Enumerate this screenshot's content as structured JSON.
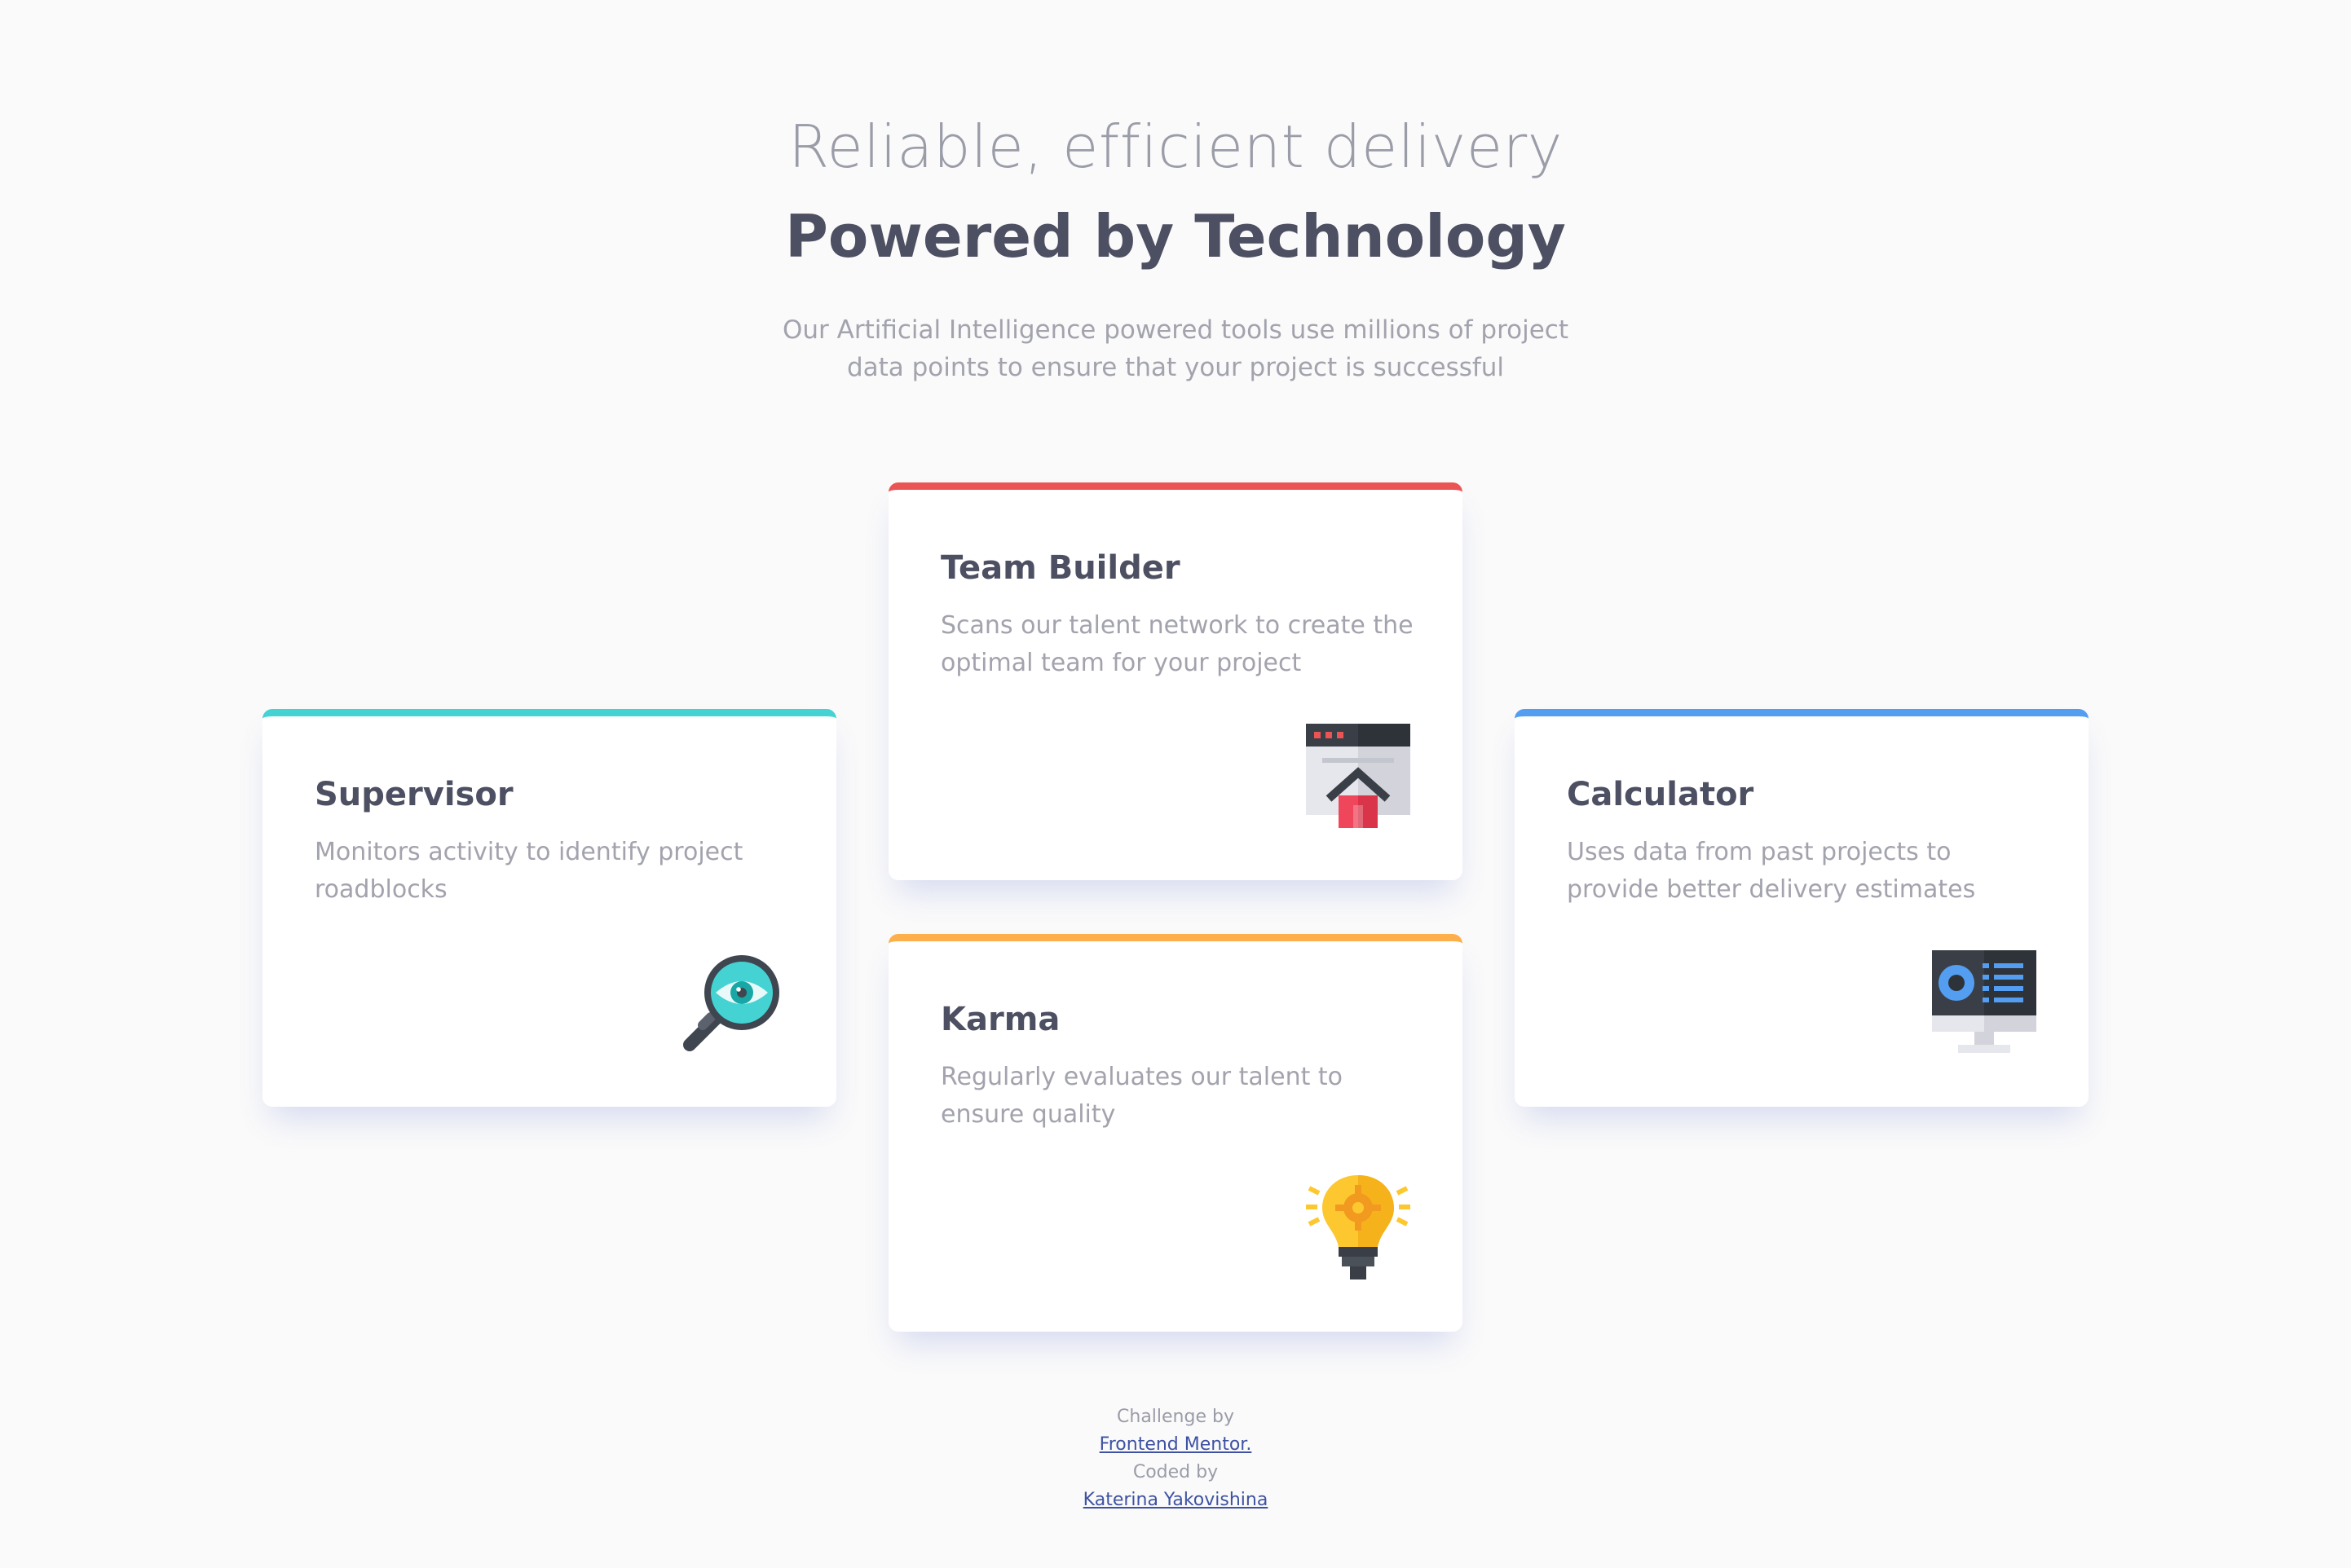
{
  "header": {
    "subtitle": "Reliable, efficient delivery",
    "title": "Powered by Technology",
    "description": "Our Artificial Intelligence powered tools use millions of project data points to ensure that your project is successful"
  },
  "cards": {
    "supervisor": {
      "title": "Supervisor",
      "description": "Monitors activity to identify project roadblocks",
      "accent": "#44d3d2",
      "icon": "magnifier-eye-icon"
    },
    "team_builder": {
      "title": "Team Builder",
      "description": "Scans our talent network to create the optimal team for your project",
      "accent": "#ea5454",
      "icon": "browser-house-icon"
    },
    "karma": {
      "title": "Karma",
      "description": "Regularly evaluates our talent to ensure quality",
      "accent": "#fcaf4a",
      "icon": "lightbulb-icon"
    },
    "calculator": {
      "title": "Calculator",
      "description": "Uses data from past projects to provide better delivery estimates",
      "accent": "#549ef2",
      "icon": "monitor-chart-icon"
    }
  },
  "footer": {
    "challenge_label": "Challenge by",
    "challenge_link": "Frontend Mentor.",
    "coded_label": "Coded by",
    "coded_link": "Katerina Yakovishina"
  }
}
